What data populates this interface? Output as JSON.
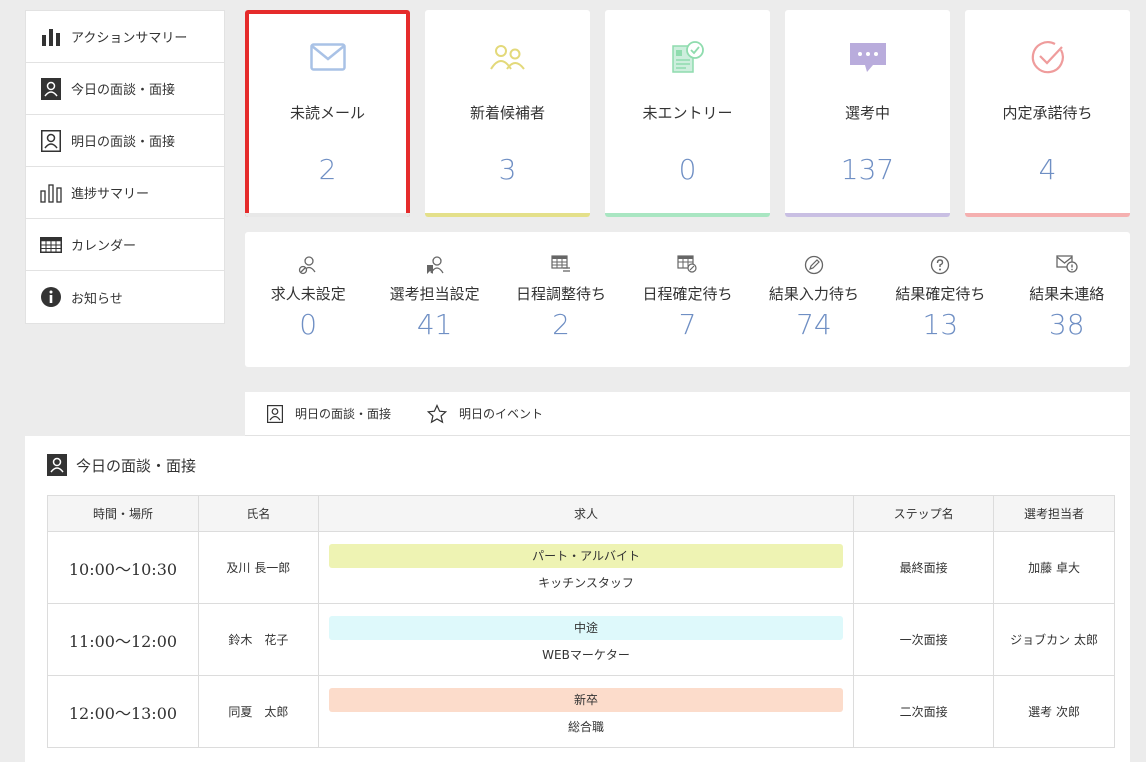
{
  "sidebar": {
    "items": [
      {
        "label": "アクションサマリー",
        "icon": "bar-chart-icon"
      },
      {
        "label": "今日の面談・面接",
        "icon": "person-filled-icon"
      },
      {
        "label": "明日の面談・面接",
        "icon": "person-outline-icon"
      },
      {
        "label": "進捗サマリー",
        "icon": "bar-outline-icon"
      },
      {
        "label": "カレンダー",
        "icon": "calendar-icon"
      },
      {
        "label": "お知らせ",
        "icon": "info-icon"
      }
    ]
  },
  "cards": [
    {
      "title": "未読メール",
      "count": "2",
      "color": "#a9c2e6",
      "bar": "#e8e8e8",
      "icon": "envelope-icon"
    },
    {
      "title": "新着候補者",
      "count": "3",
      "color": "#e3d97a",
      "bar": "#e4e08a",
      "icon": "people-icon"
    },
    {
      "title": "未エントリー",
      "count": "0",
      "color": "#8fdcae",
      "bar": "#a9e6c2",
      "icon": "document-check-icon"
    },
    {
      "title": "選考中",
      "count": "137",
      "color": "#b9acdc",
      "bar": "#c9bfe3",
      "icon": "chat-bubble-icon"
    },
    {
      "title": "内定承諾待ち",
      "count": "4",
      "color": "#ef9c9c",
      "bar": "#f5b0b0",
      "icon": "check-circle-icon"
    }
  ],
  "stats": [
    {
      "title": "求人未設定",
      "count": "0",
      "icon": "person-link-icon"
    },
    {
      "title": "選考担当設定",
      "count": "41",
      "icon": "person-bookmark-icon"
    },
    {
      "title": "日程調整待ち",
      "count": "2",
      "icon": "calendar-list-icon"
    },
    {
      "title": "日程確定待ち",
      "count": "7",
      "icon": "calendar-edit-icon"
    },
    {
      "title": "結果入力待ち",
      "count": "74",
      "icon": "pen-circle-icon"
    },
    {
      "title": "結果確定待ち",
      "count": "13",
      "icon": "question-circle-icon"
    },
    {
      "title": "結果未連絡",
      "count": "38",
      "icon": "mail-alert-icon"
    }
  ],
  "tabs": [
    {
      "label": "明日の面談・面接",
      "icon": "person-outline-icon"
    },
    {
      "label": "明日のイベント",
      "icon": "star-icon"
    }
  ],
  "panel": {
    "title": "今日の面談・面接",
    "columns": [
      "時間・場所",
      "氏名",
      "求人",
      "ステップ名",
      "選考担当者"
    ],
    "rows": [
      {
        "time": "10:00〜10:30",
        "name": "及川 長一郎",
        "job_type": "パート・アルバイト",
        "job_color": "#eef3b3",
        "job_name": "キッチンスタッフ",
        "step": "最終面接",
        "manager": "加藤 卓大"
      },
      {
        "time": "11:00〜12:00",
        "name": "鈴木　花子",
        "job_type": "中途",
        "job_color": "#def9fb",
        "job_name": "WEBマーケター",
        "step": "一次面接",
        "manager": "ジョブカン 太郎"
      },
      {
        "time": "12:00〜13:00",
        "name": "同夏　太郎",
        "job_type": "新卒",
        "job_color": "#fcdccb",
        "job_name": "総合職",
        "step": "二次面接",
        "manager": "選考 次郎"
      }
    ]
  }
}
